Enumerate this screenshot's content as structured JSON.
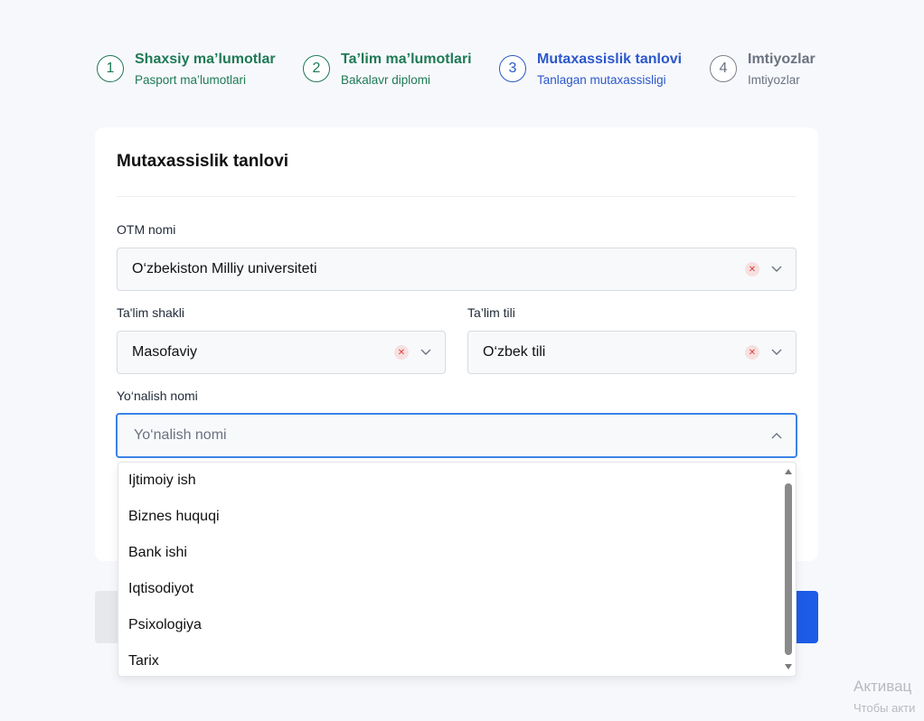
{
  "stepper": {
    "steps": [
      {
        "number": "1",
        "title": "Shaxsiy ma’lumotlar",
        "subtitle": "Pasport ma’lumotlari",
        "state": "done"
      },
      {
        "number": "2",
        "title": "Ta’lim ma’lumotlari",
        "subtitle": "Bakalavr diplomi",
        "state": "done"
      },
      {
        "number": "3",
        "title": "Mutaxassislik tanlovi",
        "subtitle": "Tanlagan mutaxassisligi",
        "state": "active"
      },
      {
        "number": "4",
        "title": "Imtiyozlar",
        "subtitle": "Imtiyozlar",
        "state": "pending"
      }
    ]
  },
  "card": {
    "title": "Mutaxassislik tanlovi",
    "otm": {
      "label": "OTM nomi",
      "value": "O‘zbekiston Milliy universiteti"
    },
    "talim_shakli": {
      "label": "Ta'lim shakli",
      "value": "Masofaviy"
    },
    "talim_tili": {
      "label": "Ta’lim tili",
      "value": "O‘zbek tili"
    },
    "yonalish": {
      "label": "Yo‘nalish nomi",
      "placeholder": "Yo‘nalish nomi",
      "value": ""
    }
  },
  "dropdown": {
    "options": [
      "Ijtimoiy ish",
      "Biznes huquqi",
      "Bank ishi",
      "Iqtisodiyot",
      "Psixologiya",
      "Tarix"
    ]
  },
  "watermark": {
    "line1": "Активац",
    "line2": "Чтобы акти"
  },
  "colors": {
    "done": "#1f7a55",
    "active": "#2b58c9",
    "pending": "#6b7280",
    "focus_border": "#3b82e6",
    "primary_button": "#1c5ce6"
  }
}
